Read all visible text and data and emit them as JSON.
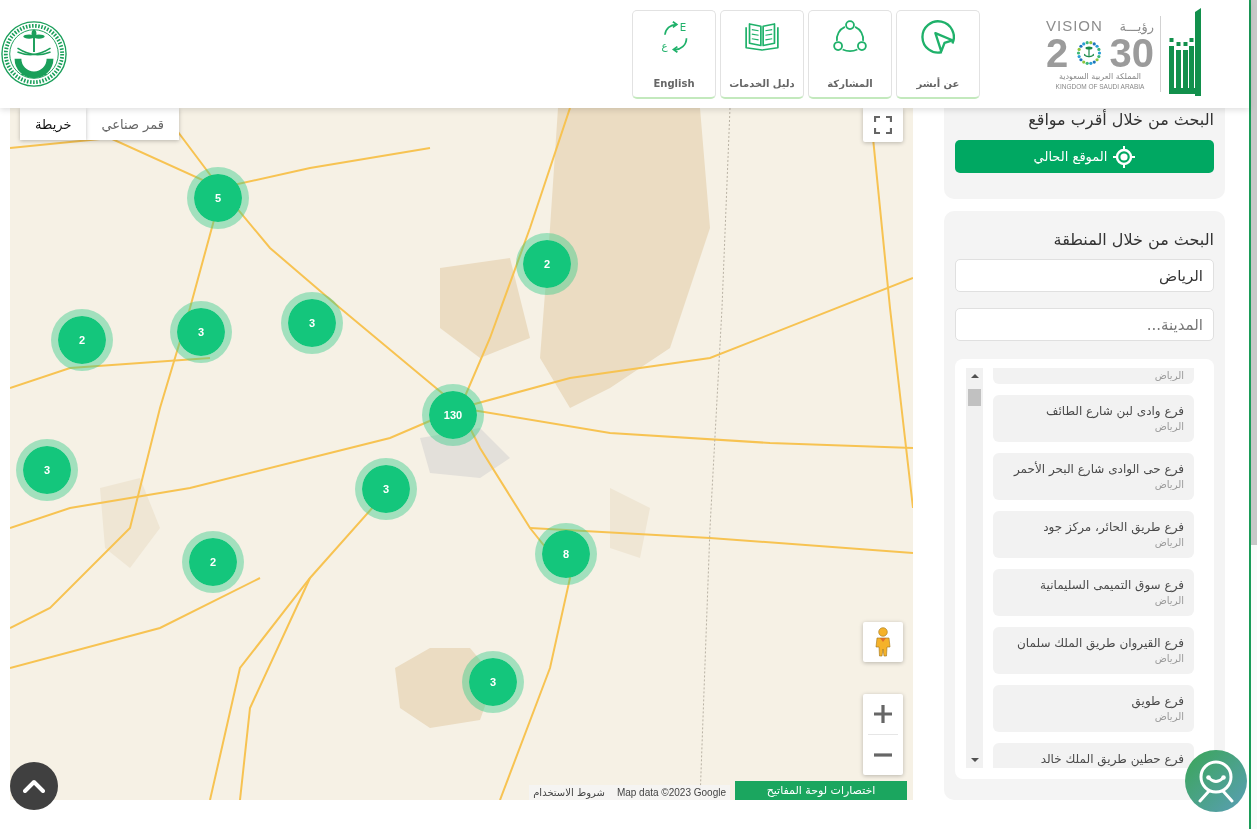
{
  "header": {
    "nav": [
      {
        "label": "عن أبشر"
      },
      {
        "label": "المشاركة"
      },
      {
        "label": "دليل الخدمات"
      },
      {
        "label": "English",
        "icon_letters": [
          "E",
          "ع"
        ]
      }
    ],
    "vision_logo": {
      "word": "VISION",
      "word_ar": "رؤيـــة",
      "year_start": "2",
      "year_end": "30",
      "country_ar": "المملكة العربية السعودية",
      "country_en": "KINGDOM OF SAUDI ARABIA"
    }
  },
  "map": {
    "type_tabs": [
      {
        "label": "قمر صناعي",
        "selected": false
      },
      {
        "label": "خريطة",
        "selected": true
      }
    ],
    "clusters": [
      {
        "count": "5"
      },
      {
        "count": "2"
      },
      {
        "count": "3"
      },
      {
        "count": "3"
      },
      {
        "count": "2"
      },
      {
        "count": "130"
      },
      {
        "count": "3"
      },
      {
        "count": "3"
      },
      {
        "count": "2"
      },
      {
        "count": "8"
      },
      {
        "count": "3"
      }
    ],
    "attribution": "Map data ©2023 Google",
    "terms_link": "شروط الاستخدام",
    "keyboard_shortcuts_button": "اختصارات لوحة المفاتيح"
  },
  "nearest_search": {
    "title": "البحث من خلال أقرب مواقع",
    "button": "الموقع الحالي"
  },
  "region_search": {
    "title": "البحث من خلال المنطقة",
    "region_field": {
      "value": "الرياض"
    },
    "city_field": {
      "placeholder": "المدينة..."
    },
    "branches": [
      {
        "region": "الرياض"
      },
      {
        "name": "فرع وادى لبن شارع الطائف",
        "region": "الرياض"
      },
      {
        "name": "فرع حى الوادى شارع البحر الأحمر",
        "region": "الرياض"
      },
      {
        "name": "فرع طريق الحائر، مركز جود",
        "region": "الرياض"
      },
      {
        "name": "فرع سوق التميمى السليمانية",
        "region": "الرياض"
      },
      {
        "name": "فرع القيروان طريق الملك سلمان",
        "region": "الرياض"
      },
      {
        "name": "فرع طويق",
        "region": "الرياض"
      },
      {
        "name": "فرع حطين طريق الملك خالد"
      }
    ]
  }
}
